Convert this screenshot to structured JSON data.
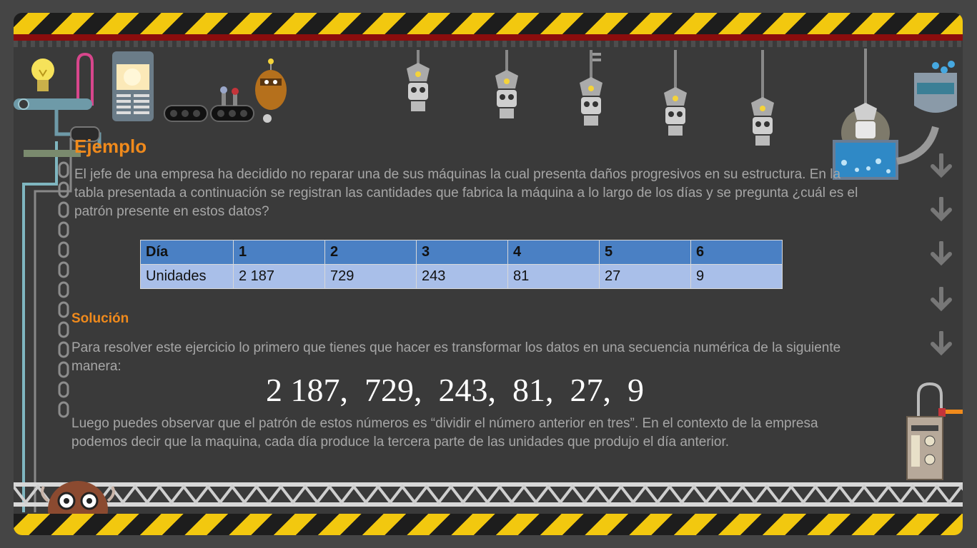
{
  "title": "Ejemplo",
  "intro": "El jefe de una empresa ha decidido no reparar una de sus máquinas la cual presenta daños progresivos en su estructura. En la tabla presentada a continuación se registran las cantidades que fabrica la máquina a lo largo de los días y se pregunta ¿cuál es el patrón presente en estos datos?",
  "table": {
    "header": [
      "Día",
      "1",
      "2",
      "3",
      "4",
      "5",
      "6"
    ],
    "row": [
      "Unidades",
      "2 187",
      "729",
      "243",
      "81",
      "27",
      "9"
    ]
  },
  "solution_label": "Solución",
  "solution_text": "Para resolver este ejercicio lo primero que tienes que hacer es transformar los datos en una secuencia numérica de la siguiente manera:",
  "sequence": "2 187,  729,  243,  81,  27,  9",
  "conclusion": "Luego puedes observar que el patrón de estos números es “dividir el número anterior en tres”. En el contexto de la empresa podemos decir que la maquina, cada día produce la tercera parte de las unidades que produjo el día anterior.",
  "colors": {
    "accent": "#f08a1c",
    "table_header": "#4a80c4",
    "table_row": "#a9bfe9",
    "hazard_yellow": "#f2c80f"
  },
  "icons": [
    "lightbulb-icon",
    "control-panel-icon",
    "conveyor-icon",
    "robot-worker-icon",
    "hanging-robot-icon",
    "water-tank-icon",
    "down-arrow-icon",
    "mole-robot-icon",
    "machine-console-icon"
  ]
}
